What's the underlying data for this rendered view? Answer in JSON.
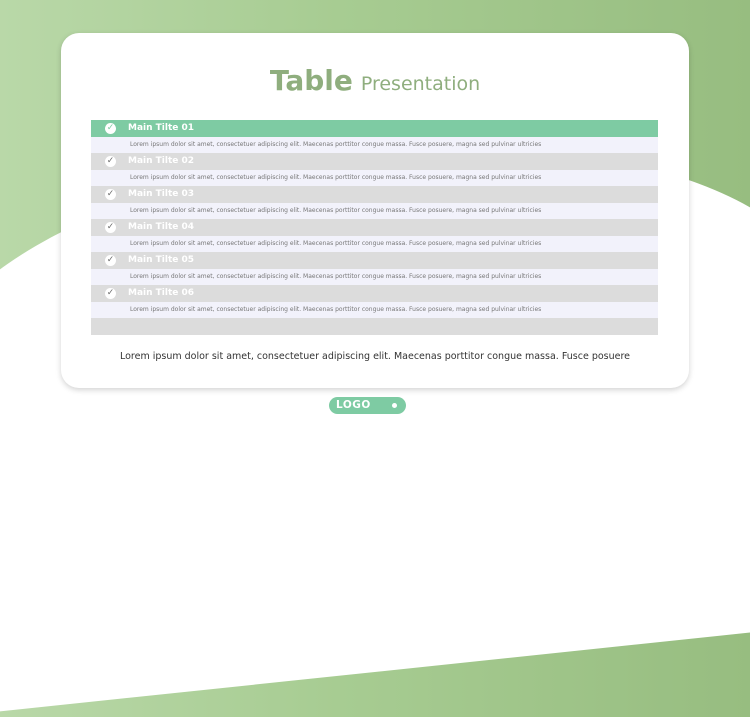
{
  "colors": {
    "accent": "#7ecba3",
    "title": "#8fae7e",
    "row_header": "#dcdcdc",
    "row_body": "#f2f2fb",
    "background_green": "#a7cc92"
  },
  "title": {
    "main": "Table",
    "sub": "Presentation"
  },
  "table": {
    "rows": [
      {
        "title": "Main Tilte 01",
        "text": "Lorem ipsum dolor sit amet, consectetuer adipiscing elit. Maecenas porttitor congue massa. Fusce posuere, magna sed pulvinar ultricies",
        "icon": "check-circle-icon",
        "active": true
      },
      {
        "title": "Main Tilte 02",
        "text": "Lorem ipsum dolor sit amet, consectetuer adipiscing elit. Maecenas porttitor congue massa. Fusce posuere, magna sed pulvinar ultricies",
        "icon": "check-circle-icon",
        "active": false
      },
      {
        "title": "Main Tilte 03",
        "text": "Lorem ipsum dolor sit amet, consectetuer adipiscing elit. Maecenas porttitor congue massa. Fusce posuere, magna sed pulvinar ultricies",
        "icon": "check-circle-icon",
        "active": false
      },
      {
        "title": "Main Tilte 04",
        "text": "Lorem ipsum dolor sit amet, consectetuer adipiscing elit. Maecenas porttitor congue massa. Fusce posuere, magna sed pulvinar ultricies",
        "icon": "check-circle-icon",
        "active": false
      },
      {
        "title": "Main Tilte 05",
        "text": "Lorem ipsum dolor sit amet, consectetuer adipiscing elit. Maecenas porttitor congue massa. Fusce posuere, magna sed pulvinar ultricies",
        "icon": "check-circle-icon",
        "active": false
      },
      {
        "title": "Main Tilte 06",
        "text": "Lorem ipsum dolor sit amet, consectetuer adipiscing elit. Maecenas porttitor congue massa. Fusce posuere, magna sed pulvinar ultricies",
        "icon": "check-circle-icon",
        "active": false
      }
    ]
  },
  "footer": {
    "text": "Lorem ipsum dolor sit amet, consectetuer adipiscing elit. Maecenas porttitor congue massa. Fusce posuere"
  },
  "logo": {
    "label": "LOGO"
  }
}
